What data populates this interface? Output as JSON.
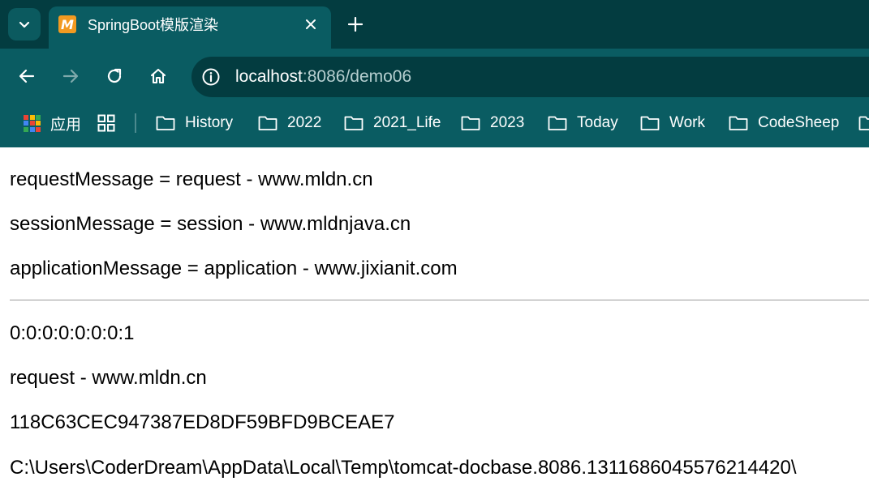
{
  "browser": {
    "tab": {
      "title": "SpringBoot模版渲染",
      "favicon_letter": "M",
      "favicon_color": "#f29a21"
    },
    "address_bar": {
      "url_host": "localhost",
      "url_path": ":8086/demo06"
    },
    "icons": {
      "tab_search": "chevron-down-icon",
      "close": "close-icon",
      "new_tab": "plus-icon",
      "back": "arrow-left-icon",
      "forward": "arrow-right-icon",
      "reload": "reload-icon",
      "home": "home-icon",
      "site_info": "info-circle-icon"
    },
    "bookmarks": {
      "apps_label": "应用",
      "items": [
        {
          "label": "History"
        },
        {
          "label": "2022"
        },
        {
          "label": "2021_Life"
        },
        {
          "label": "2023"
        },
        {
          "label": "Today"
        },
        {
          "label": "Work"
        },
        {
          "label": "CodeSheep"
        },
        {
          "label": ""
        }
      ]
    },
    "theme": {
      "frame": "#033c40",
      "toolbar": "#0a5c62",
      "text": "#ffffff"
    }
  },
  "page": {
    "lines_top": [
      "requestMessage = request - www.mldn.cn",
      "sessionMessage = session - www.mldnjava.cn",
      "applicationMessage = application - www.jixianit.com"
    ],
    "lines_bottom": [
      "0:0:0:0:0:0:0:1",
      "request - www.mldn.cn",
      "118C63CEC947387ED8DF59BFD9BCEAE7",
      "C:\\Users\\CoderDream\\AppData\\Local\\Temp\\tomcat-docbase.8086.1311686045576214420\\"
    ]
  }
}
